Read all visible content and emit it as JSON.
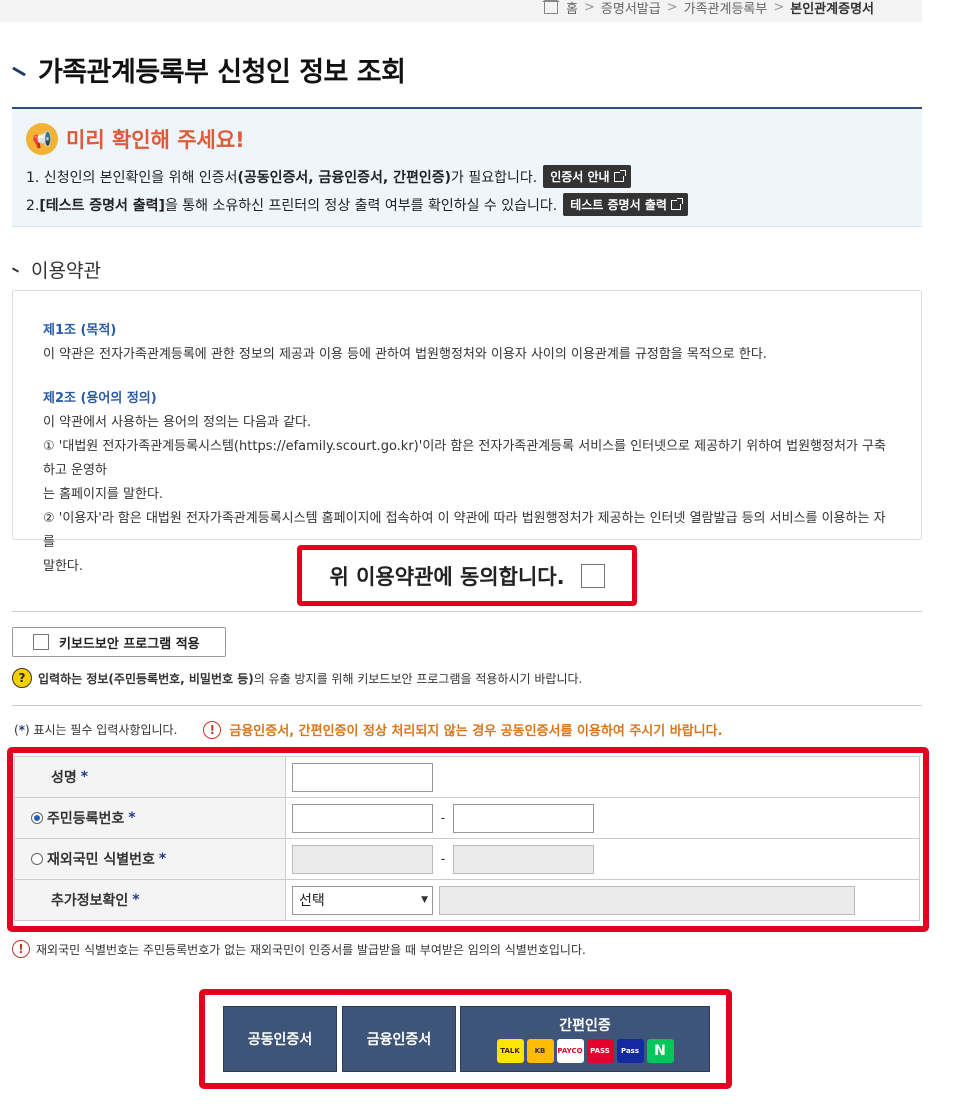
{
  "breadcrumb": {
    "home": "홈",
    "items": [
      "증명서발급",
      "가족관계등록부"
    ],
    "current": "본인관계증명서"
  },
  "page_title": "가족관계등록부 신청인 정보 조회",
  "notice": {
    "title": "미리 확인해 주세요!",
    "line1_a": "1. 신청인의 본인확인을 위해 인증서",
    "line1_b": "(공동인증서, 금융인증서, 간편인증)",
    "line1_c": "가 필요합니다.",
    "line1_btn": "인증서 안내",
    "line2_a": "2.",
    "line2_b": "[테스트 증명서 출력]",
    "line2_c": "을 통해 소유하신 프린터의 정상 출력 여부를 확인하실 수 있습니다.",
    "line2_btn": "테스트 증명서 출력"
  },
  "terms": {
    "title": "이용약관",
    "art1_title": "제1조 (목적)",
    "art1_body": "이 약관은 전자가족관계등록에 관한 정보의 제공과 이용 등에 관하여 법원행정처와 이용자 사이의 이용관계를 규정함을 목적으로 한다.",
    "art2_title": "제2조 (용어의 정의)",
    "art2_body1": "이 약관에서 사용하는 용어의 정의는 다음과 같다.",
    "art2_item1a": "① '대법원 전자가족관계등록시스템(https://efamily.scourt.go.kr)'이라 함은 전자가족관계등록 서비스를 인터넷으로 제공하기 위하여 법원행정처가 구축하고 운영하",
    "art2_item1b": "는 홈페이지를 말한다.",
    "art2_item2a": "② '이용자'라 함은 대법원 전자가족관계등록시스템 홈페이지에 접속하여 이 약관에 따라 법원행정처가 제공하는 인터넷 열람발급 등의 서비스를 이용하는 자를",
    "art2_item2b": "말한다."
  },
  "agree_label": "위 이용약관에 동의합니다.",
  "keyboard_security_label": "키보드보안 프로그램 적용",
  "keyboard_help_a": "입력하는 정보",
  "keyboard_help_b": "(주민등록번호, 비밀번호 등)",
  "keyboard_help_c": "의 유출 방지를 위해 키보드보안 프로그램을 적용하시기 바랍니다.",
  "required_note_a": "(",
  "required_note_star": "*",
  "required_note_b": ") 표시는 필수 입력사항입니다.",
  "warning_text": "금융인증서, 간편인증이 정상 처리되지 않는 경우 공동인증서를 이용하여 주시기 바랍니다.",
  "form": {
    "name_label": "성명",
    "rrn_label": "주민등록번호",
    "foreign_label": "재외국민 식별번호",
    "extra_label": "추가정보확인",
    "required_mark": "*",
    "separator": "-",
    "select_value": "선택"
  },
  "foot_note": "재외국민 식별번호는 주민등록번호가 없는 재외국민이 인증서를 발급받을 때 부여받은 임의의 식별번호입니다.",
  "buttons": {
    "joint_cert": "공동인증서",
    "financial_cert": "금융인증서",
    "simple_auth": "간편인증",
    "logos": [
      "TALK",
      "KB",
      "PAYCO",
      "PASS",
      "Pass",
      "N"
    ]
  },
  "colors": {
    "accent_red": "#e6001f",
    "navy_button": "#3e5479",
    "notice_bg": "#eef6fc",
    "warn_orange": "#d9761a"
  }
}
